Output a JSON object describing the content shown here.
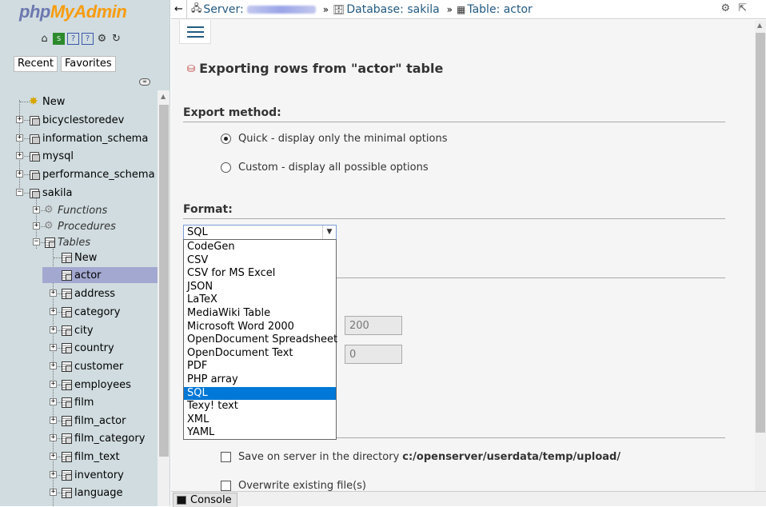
{
  "nav": {
    "logo_php": "php",
    "logo_rest": "MyAdmin",
    "icons": [
      "home-icon",
      "sql-icon",
      "docs-icon",
      "query-icon",
      "settings-icon",
      "reload-icon"
    ],
    "recent_label": "Recent",
    "favorites_label": "Favorites",
    "tree": [
      {
        "label": "New",
        "kind": "new",
        "level": 0
      },
      {
        "label": "bicyclestoredev",
        "kind": "db",
        "level": 0
      },
      {
        "label": "information_schema",
        "kind": "db",
        "level": 0
      },
      {
        "label": "mysql",
        "kind": "db",
        "level": 0
      },
      {
        "label": "performance_schema",
        "kind": "db",
        "level": 0
      },
      {
        "label": "sakila",
        "kind": "db",
        "level": 0,
        "expanded": true
      },
      {
        "label": "Functions",
        "kind": "group",
        "level": 1
      },
      {
        "label": "Procedures",
        "kind": "group",
        "level": 1
      },
      {
        "label": "Tables",
        "kind": "group",
        "level": 1,
        "expanded": true
      },
      {
        "label": "New",
        "kind": "newtable",
        "level": 2
      },
      {
        "label": "actor",
        "kind": "table",
        "level": 2,
        "selected": true
      },
      {
        "label": "address",
        "kind": "table",
        "level": 2
      },
      {
        "label": "category",
        "kind": "table",
        "level": 2
      },
      {
        "label": "city",
        "kind": "table",
        "level": 2
      },
      {
        "label": "country",
        "kind": "table",
        "level": 2
      },
      {
        "label": "customer",
        "kind": "table",
        "level": 2
      },
      {
        "label": "employees",
        "kind": "table",
        "level": 2
      },
      {
        "label": "film",
        "kind": "table",
        "level": 2
      },
      {
        "label": "film_actor",
        "kind": "table",
        "level": 2
      },
      {
        "label": "film_category",
        "kind": "table",
        "level": 2
      },
      {
        "label": "film_text",
        "kind": "table",
        "level": 2
      },
      {
        "label": "inventory",
        "kind": "table",
        "level": 2
      },
      {
        "label": "language",
        "kind": "table",
        "level": 2
      }
    ]
  },
  "breadcrumb": {
    "server_label": "Server:",
    "database_label": "Database: sakila",
    "table_label": "Table: actor",
    "separator": "»"
  },
  "main": {
    "title": "Exporting rows from \"actor\" table",
    "export_method": {
      "heading": "Export method:",
      "options": [
        {
          "label": "Quick - display only the minimal options",
          "checked": true
        },
        {
          "label": "Custom - display all possible options",
          "checked": false
        }
      ]
    },
    "format": {
      "heading": "Format:",
      "selected": "SQL",
      "options": [
        "CodeGen",
        "CSV",
        "CSV for MS Excel",
        "JSON",
        "LaTeX",
        "MediaWiki Table",
        "Microsoft Word 2000",
        "OpenDocument Spreadsheet",
        "OpenDocument Text",
        "PDF",
        "PHP array",
        "SQL",
        "Texy! text",
        "XML",
        "YAML"
      ]
    },
    "rows_field_1": "200",
    "rows_field_2": "0",
    "save_on_server_label": "Save on server in the directory",
    "save_dir": "c:/openserver/userdata/temp/upload/",
    "overwrite_label": "Overwrite existing file(s)"
  },
  "console": {
    "label": "Console"
  }
}
